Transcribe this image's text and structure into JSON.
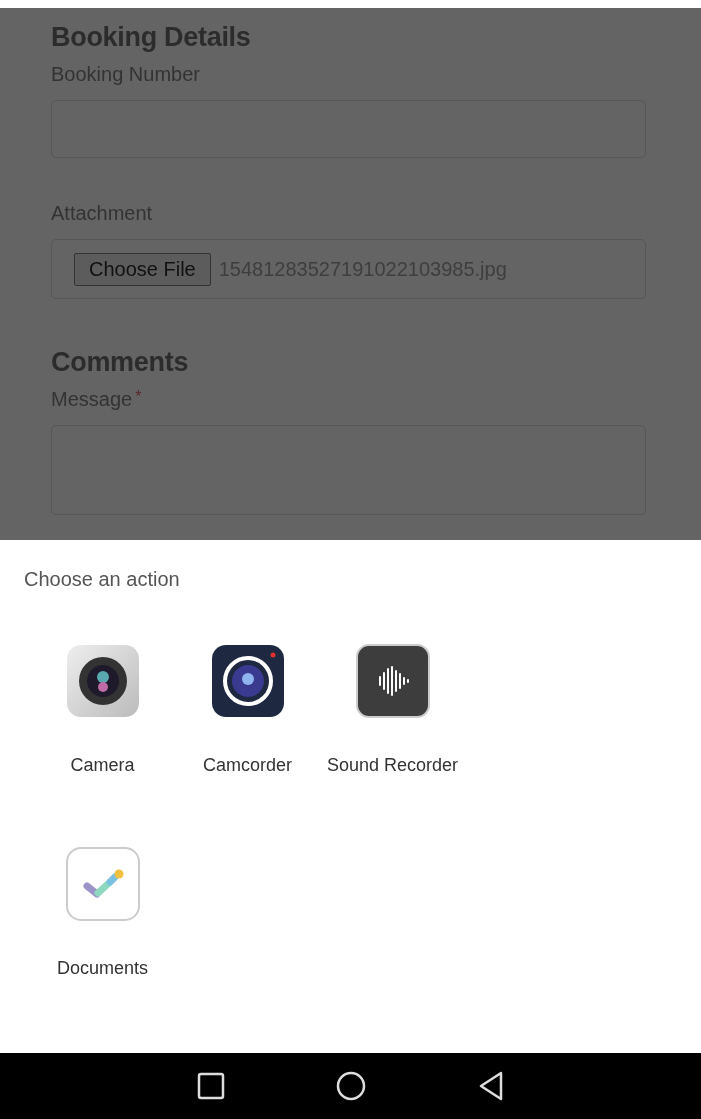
{
  "form": {
    "sections": [
      {
        "heading": "Booking Details",
        "fields": [
          {
            "label": "Booking Number",
            "kind": "text"
          },
          {
            "label": "Attachment",
            "kind": "file",
            "button": "Choose File",
            "value": "15481283527191022103985.jpg"
          }
        ]
      },
      {
        "heading": "Comments",
        "fields": [
          {
            "label": "Message",
            "kind": "textarea",
            "required": true,
            "required_mark": "*"
          }
        ]
      }
    ]
  },
  "sheet": {
    "title": "Choose an action",
    "apps": [
      {
        "name": "Camera",
        "kind": "camera"
      },
      {
        "name": "Camcorder",
        "kind": "camcorder"
      },
      {
        "name": "Sound Recorder",
        "kind": "recorder"
      },
      {
        "name": "Documents",
        "kind": "documents"
      }
    ]
  }
}
